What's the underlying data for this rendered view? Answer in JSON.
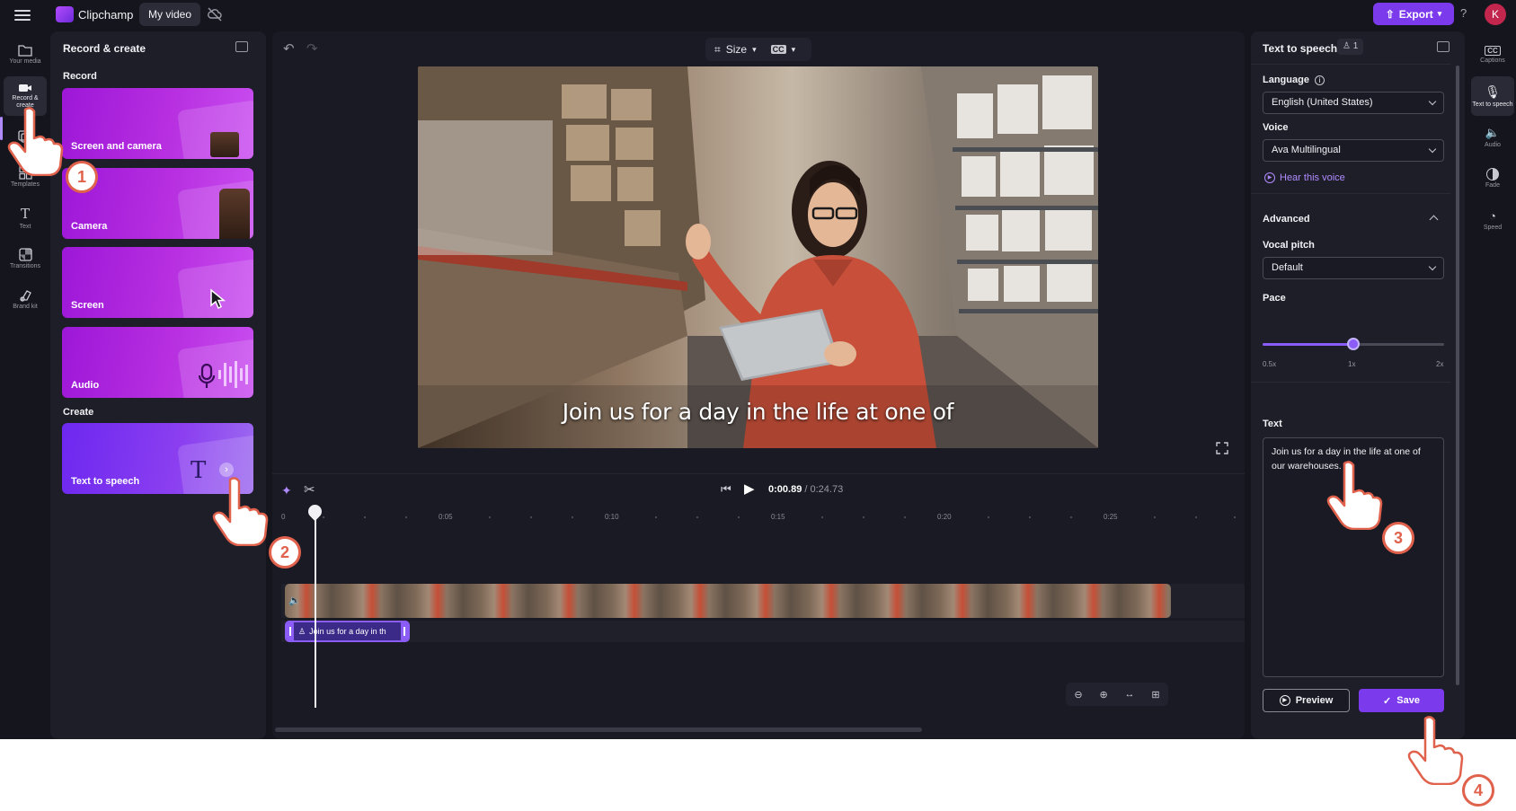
{
  "app": {
    "brand": "Clipchamp",
    "project_name": "My video",
    "export_label": "Export",
    "help_label": "?",
    "avatar_initial": "K",
    "accent_color": "#7c3aed"
  },
  "left_rail": {
    "items": [
      {
        "icon": "folder-icon",
        "label": "Your media"
      },
      {
        "icon": "camera-icon",
        "label": "Record & create"
      },
      {
        "icon": "stock-icon",
        "label": ""
      },
      {
        "icon": "templates-icon",
        "label": "Templates"
      },
      {
        "icon": "text-icon",
        "label": "Text"
      },
      {
        "icon": "transitions-icon",
        "label": "Transitions"
      },
      {
        "icon": "brand-kit-icon",
        "label": "Brand kit"
      }
    ]
  },
  "record_panel": {
    "title": "Record & create",
    "record_heading": "Record",
    "cards": [
      {
        "label": "Screen and camera"
      },
      {
        "label": "Camera"
      },
      {
        "label": "Screen"
      },
      {
        "label": "Audio"
      }
    ],
    "create_heading": "Create",
    "create_card": {
      "label": "Text to speech"
    }
  },
  "stage": {
    "size_label": "Size",
    "subtitle": "Join us for a day in the life at one of",
    "timecode_current": "0:00.89",
    "timecode_total": "/ 0:24.73",
    "ruler_ticks": [
      "0",
      "0:05",
      "0:10",
      "0:15",
      "0:20",
      "0:25"
    ],
    "tts_clip_label": "Join us for a day in th"
  },
  "tts_panel": {
    "title": "Text to speech",
    "badge": "1",
    "language_label": "Language",
    "language_value": "English (United States)",
    "voice_label": "Voice",
    "voice_value": "Ava Multilingual",
    "hear_voice": "Hear this voice",
    "advanced_label": "Advanced",
    "pitch_label": "Vocal pitch",
    "pitch_value": "Default",
    "pace_label": "Pace",
    "pace_marks": [
      "0.5x",
      "1x",
      "2x"
    ],
    "pace_value": 1.0,
    "text_label": "Text",
    "text_value": "Join us for a day in the life at one of our warehouses.",
    "preview_label": "Preview",
    "save_label": "Save"
  },
  "right_rail": {
    "items": [
      {
        "icon": "captions-icon",
        "label": "Captions"
      },
      {
        "icon": "text-to-speech-icon",
        "label": "Text to speech"
      },
      {
        "icon": "audio-icon",
        "label": "Audio"
      },
      {
        "icon": "fade-icon",
        "label": "Fade"
      },
      {
        "icon": "speed-icon",
        "label": "Speed"
      }
    ]
  },
  "annotations": {
    "steps": [
      "1",
      "2",
      "3",
      "4"
    ]
  }
}
